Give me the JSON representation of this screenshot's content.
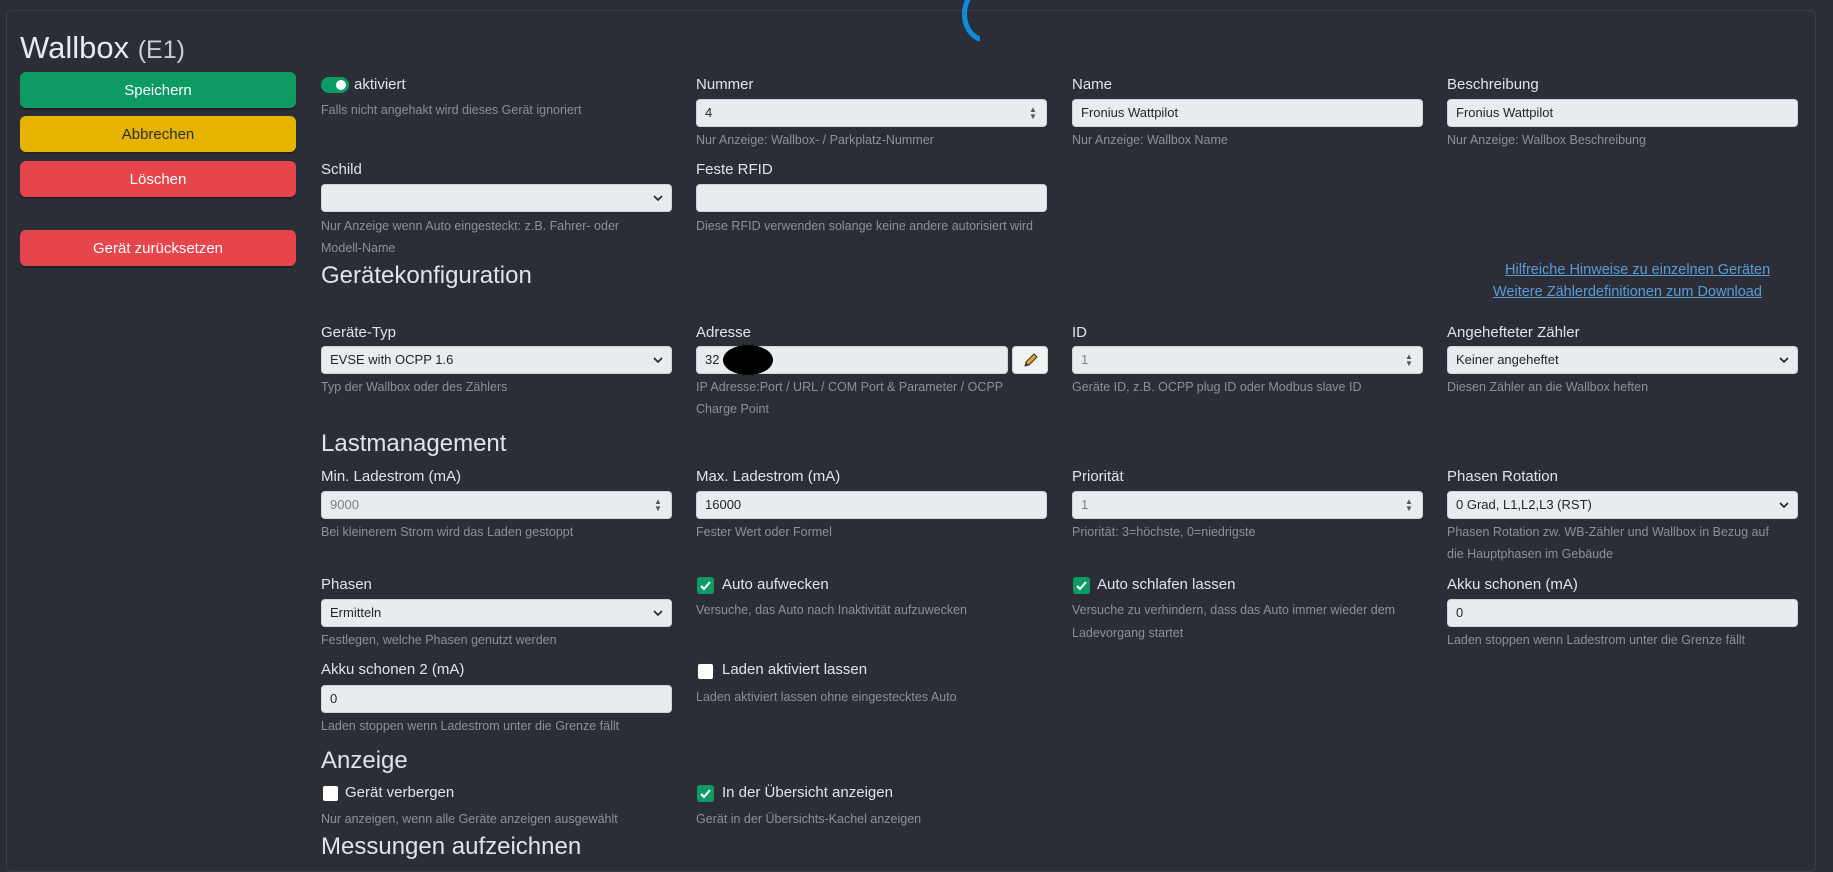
{
  "header": {
    "title": "Wallbox",
    "subtitle": "(E1)"
  },
  "buttons": {
    "save": "Speichern",
    "cancel": "Abbrechen",
    "delete": "Löschen",
    "reset": "Gerät zurücksetzen"
  },
  "general": {
    "enabled": {
      "label": "aktiviert",
      "checked": true,
      "help": "Falls nicht angehakt wird dieses Gerät ignoriert"
    },
    "number": {
      "label": "Nummer",
      "value": "4",
      "help": "Nur Anzeige: Wallbox- / Parkplatz-Nummer"
    },
    "name": {
      "label": "Name",
      "value": "Fronius Wattpilot",
      "help": "Nur Anzeige: Wallbox Name"
    },
    "description": {
      "label": "Beschreibung",
      "value": "Fronius Wattpilot",
      "help": "Nur Anzeige: Wallbox Beschreibung"
    },
    "sign": {
      "label": "Schild",
      "value": "",
      "help_line1": "Nur Anzeige wenn Auto eingesteckt: z.B. Fahrer- oder",
      "help_line2": "Modell-Name"
    },
    "rfid": {
      "label": "Feste RFID",
      "value": "",
      "help": "Diese RFID verwenden solange keine andere autorisiert wird"
    }
  },
  "device_config": {
    "title": "Gerätekonfiguration",
    "link1": "Hilfreiche Hinweise zu einzelnen Geräten",
    "link2": "Weitere Zählerdefinitionen zum Download",
    "device_type": {
      "label": "Geräte-Typ",
      "value": "EVSE with OCPP 1.6",
      "help": "Typ der Wallbox oder des Zählers"
    },
    "address": {
      "label": "Adresse",
      "value": "32",
      "help_line1": "IP Adresse:Port / URL / COM Port & Parameter / OCPP",
      "help_line2": "Charge Point"
    },
    "id": {
      "label": "ID",
      "value": "1",
      "help": "Geräte ID, z.B. OCPP plug ID oder Modbus slave ID"
    },
    "attached_meter": {
      "label": "Angehefteter Zähler",
      "value": "Keiner angeheftet",
      "help": "Diesen Zähler an die Wallbox heften"
    }
  },
  "load_management": {
    "title": "Lastmanagement",
    "min_current": {
      "label": "Min. Ladestrom (mA)",
      "value": "9000",
      "help": "Bei kleinerem Strom wird das Laden gestoppt"
    },
    "max_current": {
      "label": "Max. Ladestrom (mA)",
      "value": "16000",
      "help": "Fester Wert oder Formel"
    },
    "priority": {
      "label": "Priorität",
      "value": "1",
      "help": "Priorität: 3=höchste, 0=niedrigste"
    },
    "phase_rotation": {
      "label": "Phasen Rotation",
      "value": "0 Grad, L1,L2,L3 (RST)",
      "help_line1": "Phasen Rotation zw. WB-Zähler und Wallbox in Bezug auf",
      "help_line2": "die Hauptphasen im Gebäude"
    },
    "phases": {
      "label": "Phasen",
      "value": "Ermitteln",
      "help": "Festlegen, welche Phasen genutzt werden"
    },
    "auto_wake": {
      "label": "Auto aufwecken",
      "checked": true,
      "help": "Versuche, das Auto nach Inaktivität aufzuwecken"
    },
    "auto_sleep": {
      "label": "Auto schlafen lassen",
      "checked": true,
      "help_line1": "Versuche zu verhindern, dass das Auto immer wieder dem",
      "help_line2": "Ladevorgang startet"
    },
    "battery_save": {
      "label": "Akku schonen (mA)",
      "value": "0",
      "help": "Laden stoppen wenn Ladestrom unter die Grenze fällt"
    },
    "battery_save2": {
      "label": "Akku schonen 2 (mA)",
      "value": "0",
      "help": "Laden stoppen wenn Ladestrom unter die Grenze fällt"
    },
    "keep_enabled": {
      "label": "Laden aktiviert lassen",
      "checked": false,
      "help": "Laden aktiviert lassen ohne eingestecktes Auto"
    }
  },
  "display": {
    "title": "Anzeige",
    "hide_device": {
      "label": "Gerät verbergen",
      "checked": false,
      "help": "Nur anzeigen, wenn alle Geräte anzeigen ausgewählt"
    },
    "show_overview": {
      "label": "In der Übersicht anzeigen",
      "checked": true,
      "help": "Gerät in der Übersichts-Kachel anzeigen"
    }
  },
  "measurements": {
    "title": "Messungen aufzeichnen"
  },
  "colors": {
    "primary": "#0d9a63",
    "warning": "#e7b301",
    "danger": "#e5454b",
    "background": "#2b2e36",
    "link": "#5b9bd5"
  },
  "icons": {
    "pencil": "pencil-icon",
    "chevron": "chevron-down-icon",
    "spinner": "spinner-arrows-icon",
    "check": "check-icon"
  }
}
